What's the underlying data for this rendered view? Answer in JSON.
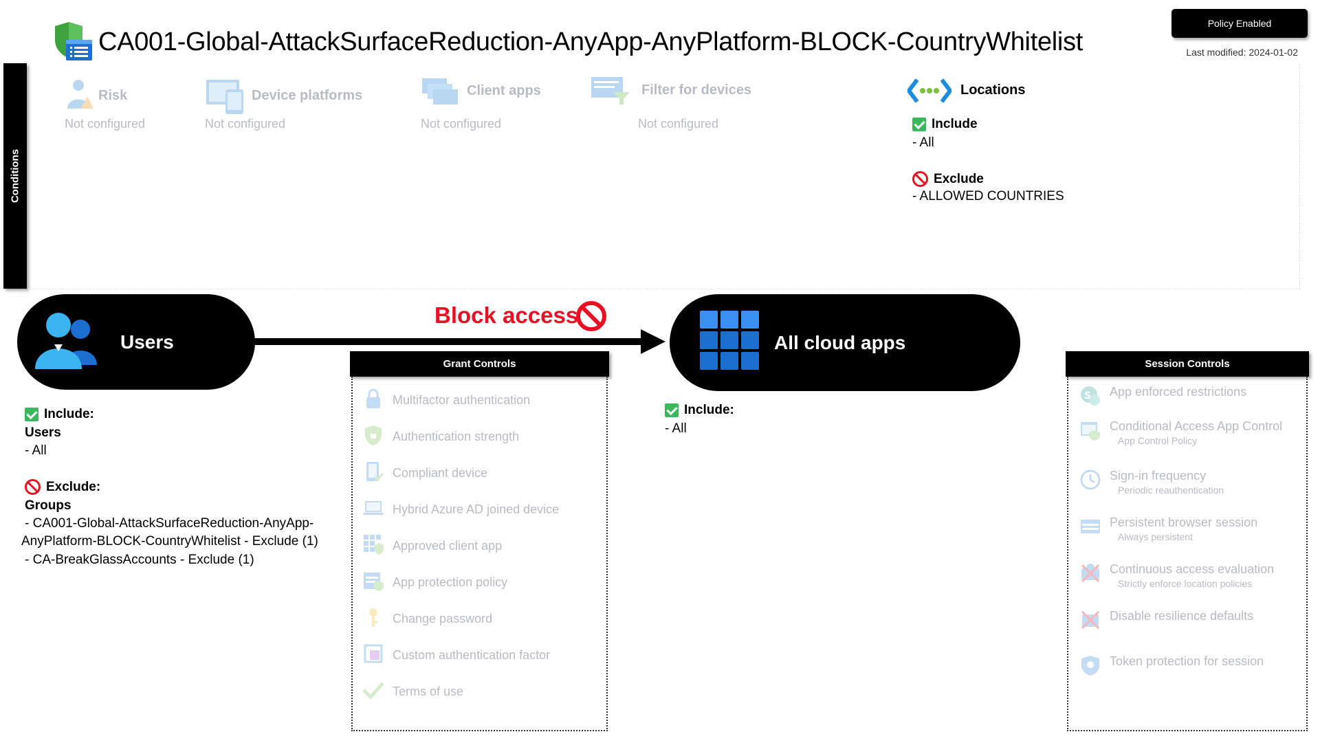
{
  "header": {
    "title": "CA001-Global-AttackSurfaceReduction-AnyApp-AnyPlatform-BLOCK-CountryWhitelist",
    "status": "Policy Enabled",
    "last_modified": "Last modified: 2024-01-02",
    "title_icon": "shield-policy-icon"
  },
  "conditions": {
    "tab_label": "Conditions",
    "risk": {
      "title": "Risk",
      "value": "Not configured",
      "icon": "risk-user-icon"
    },
    "device_platforms": {
      "title": "Device platforms",
      "value": "Not configured",
      "icon": "device-platforms-icon"
    },
    "client_apps": {
      "title": "Client apps",
      "value": "Not configured",
      "icon": "client-apps-icon"
    },
    "filter_devices": {
      "title": "Filter for devices",
      "value": "Not configured",
      "icon": "filter-devices-icon"
    },
    "locations": {
      "title": "Locations",
      "icon": "locations-icon",
      "include_label": "Include",
      "include_value": "- All",
      "exclude_label": "Exclude",
      "exclude_value": "- ALLOWED COUNTRIES"
    }
  },
  "flow": {
    "users_label": "Users",
    "action_label": "Block access",
    "apps_label": "All cloud apps",
    "colors": {
      "block": "#e81123",
      "pill": "#000000",
      "check": "#3bb85e"
    }
  },
  "users": {
    "include_label": "Include:",
    "include_group": "Users",
    "include_value": "- All",
    "exclude_label": "Exclude:",
    "exclude_group": "Groups",
    "exclude_line1": "- CA001-Global-AttackSurfaceReduction-AnyApp-",
    "exclude_line2": "AnyPlatform-BLOCK-CountryWhitelist - Exclude (1)",
    "exclude_line3": "- CA-BreakGlassAccounts - Exclude (1)"
  },
  "apps": {
    "include_label": "Include:",
    "include_value": "- All"
  },
  "grant_controls": {
    "title": "Grant Controls",
    "items": [
      {
        "label": "Multifactor authentication",
        "icon": "mfa-lock-icon"
      },
      {
        "label": "Authentication strength",
        "icon": "auth-strength-shield-icon"
      },
      {
        "label": "Compliant device",
        "icon": "compliant-device-icon"
      },
      {
        "label": "Hybrid Azure AD joined device",
        "icon": "hybrid-device-icon"
      },
      {
        "label": "Approved client app",
        "icon": "approved-app-icon"
      },
      {
        "label": "App protection policy",
        "icon": "app-protection-icon"
      },
      {
        "label": "Change password",
        "icon": "key-icon"
      },
      {
        "label": "Custom authentication factor",
        "icon": "custom-factor-icon"
      },
      {
        "label": "Terms of use",
        "icon": "terms-check-icon"
      }
    ]
  },
  "session_controls": {
    "title": "Session Controls",
    "items": [
      {
        "label": "App enforced restrictions",
        "sub": "",
        "icon": "sharepoint-icon"
      },
      {
        "label": "Conditional Access App Control",
        "sub": "App Control Policy",
        "icon": "app-control-icon"
      },
      {
        "label": "Sign-in frequency",
        "sub": "Periodic reauthentication",
        "icon": "clock-icon"
      },
      {
        "label": "Persistent browser session",
        "sub": "Always persistent",
        "icon": "browser-icon"
      },
      {
        "label": "Continuous access evaluation",
        "sub": "Strictly enforce location policies",
        "icon": "cae-icon"
      },
      {
        "label": "Disable resilience defaults",
        "sub": "",
        "icon": "resilience-icon"
      },
      {
        "label": "Token protection for session",
        "sub": "",
        "icon": "token-shield-icon"
      }
    ]
  }
}
